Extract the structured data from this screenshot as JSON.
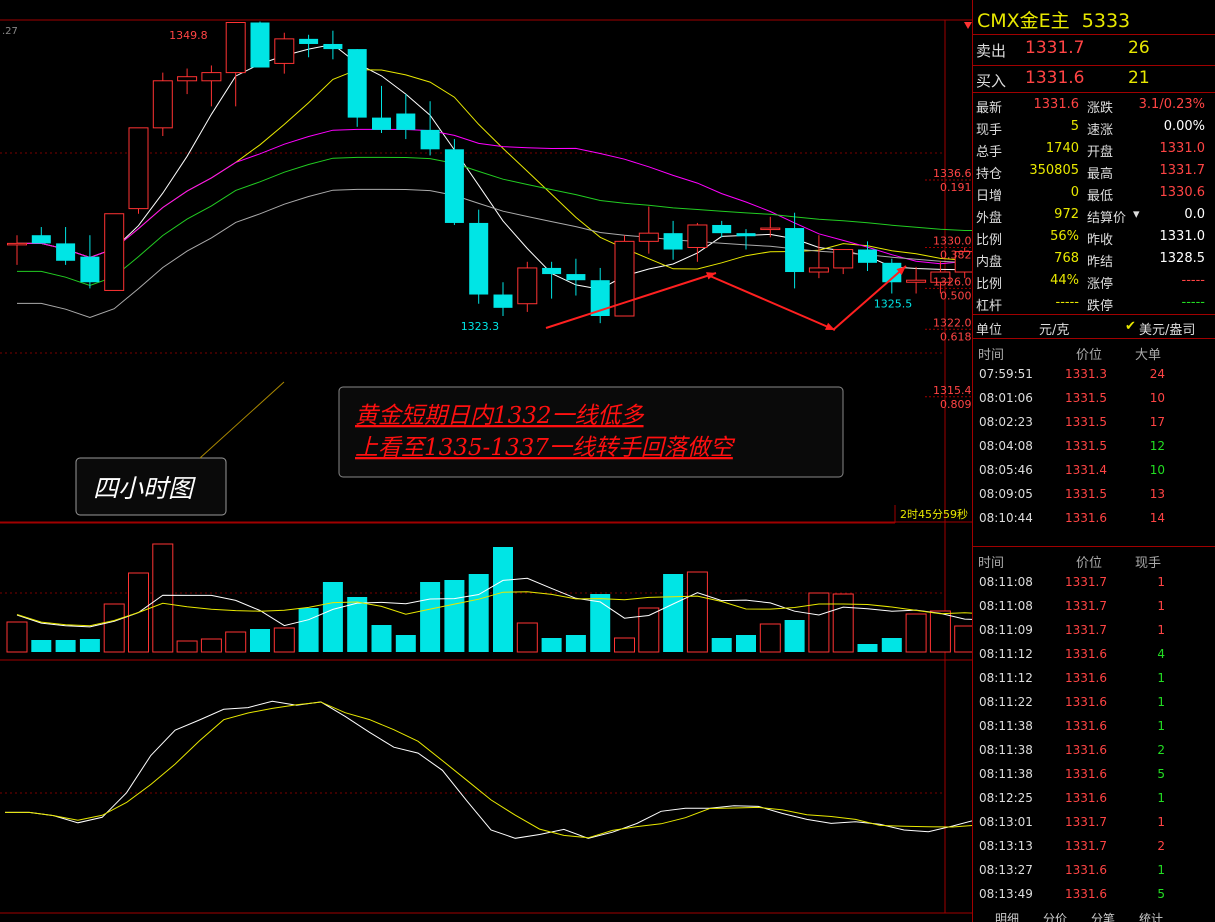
{
  "chart_data": {
    "type": "candlestick",
    "price_axis": {
      "min": 1307,
      "max": 1357
    },
    "candles": [
      {
        "o": 1330.4,
        "h": 1331.2,
        "l": 1328.3,
        "c": 1330.4
      },
      {
        "o": 1331.2,
        "h": 1332.0,
        "l": 1330.4,
        "c": 1330.4
      },
      {
        "o": 1330.4,
        "h": 1332.0,
        "l": 1328.3,
        "c": 1328.7
      },
      {
        "o": 1329.1,
        "h": 1331.2,
        "l": 1326.0,
        "c": 1326.6
      },
      {
        "o": 1325.8,
        "h": 1333.3,
        "l": 1325.8,
        "c": 1333.3
      },
      {
        "o": 1333.8,
        "h": 1341.7,
        "l": 1333.3,
        "c": 1341.7
      },
      {
        "o": 1341.7,
        "h": 1347.1,
        "l": 1340.9,
        "c": 1346.3
      },
      {
        "o": 1346.3,
        "h": 1347.5,
        "l": 1345.0,
        "c": 1346.7
      },
      {
        "o": 1346.3,
        "h": 1347.8,
        "l": 1343.8,
        "c": 1347.1
      },
      {
        "o": 1347.1,
        "h": 1349.8,
        "l": 1343.8,
        "c": 1352.0
      },
      {
        "o": 1352.0,
        "h": 1352.1,
        "l": 1347.6,
        "c": 1347.6
      },
      {
        "o": 1348.0,
        "h": 1351.0,
        "l": 1347.0,
        "c": 1350.4
      },
      {
        "o": 1350.4,
        "h": 1350.8,
        "l": 1348.6,
        "c": 1349.9
      },
      {
        "o": 1349.9,
        "h": 1351.2,
        "l": 1348.4,
        "c": 1349.4
      },
      {
        "o": 1349.4,
        "h": 1349.4,
        "l": 1341.8,
        "c": 1342.7
      },
      {
        "o": 1342.7,
        "h": 1345.8,
        "l": 1341.2,
        "c": 1341.5
      },
      {
        "o": 1343.1,
        "h": 1345.0,
        "l": 1340.6,
        "c": 1341.5
      },
      {
        "o": 1341.5,
        "h": 1344.3,
        "l": 1339.0,
        "c": 1339.6
      },
      {
        "o": 1339.6,
        "h": 1340.6,
        "l": 1332.2,
        "c": 1332.4
      },
      {
        "o": 1332.4,
        "h": 1333.7,
        "l": 1324.5,
        "c": 1325.4
      },
      {
        "o": 1325.4,
        "h": 1326.6,
        "l": 1323.3,
        "c": 1324.1
      },
      {
        "o": 1324.5,
        "h": 1328.6,
        "l": 1323.7,
        "c": 1328.0
      },
      {
        "o": 1328.0,
        "h": 1328.6,
        "l": 1325.0,
        "c": 1327.4
      },
      {
        "o": 1327.4,
        "h": 1328.9,
        "l": 1325.3,
        "c": 1326.8
      },
      {
        "o": 1326.8,
        "h": 1328.0,
        "l": 1322.6,
        "c": 1323.3
      },
      {
        "o": 1323.3,
        "h": 1331.2,
        "l": 1323.3,
        "c": 1330.6
      },
      {
        "o": 1330.6,
        "h": 1334.0,
        "l": 1329.4,
        "c": 1331.4
      },
      {
        "o": 1331.4,
        "h": 1332.6,
        "l": 1328.8,
        "c": 1329.8
      },
      {
        "o": 1330.0,
        "h": 1332.4,
        "l": 1328.6,
        "c": 1332.2
      },
      {
        "o": 1332.2,
        "h": 1332.6,
        "l": 1331.0,
        "c": 1331.4
      },
      {
        "o": 1331.4,
        "h": 1331.8,
        "l": 1329.8,
        "c": 1331.1
      },
      {
        "o": 1331.8,
        "h": 1333.0,
        "l": 1331.0,
        "c": 1331.9
      },
      {
        "o": 1331.9,
        "h": 1333.4,
        "l": 1326.0,
        "c": 1327.6
      },
      {
        "o": 1327.6,
        "h": 1331.2,
        "l": 1327.0,
        "c": 1328.0
      },
      {
        "o": 1328.0,
        "h": 1329.8,
        "l": 1327.4,
        "c": 1329.8
      },
      {
        "o": 1329.8,
        "h": 1330.6,
        "l": 1327.7,
        "c": 1328.5
      },
      {
        "o": 1328.5,
        "h": 1328.9,
        "l": 1325.5,
        "c": 1326.6
      },
      {
        "o": 1326.6,
        "h": 1328.1,
        "l": 1325.5,
        "c": 1326.8
      },
      {
        "o": 1326.6,
        "h": 1328.7,
        "l": 1325.5,
        "c": 1327.6
      },
      {
        "o": 1327.6,
        "h": 1330.0,
        "l": 1327.0,
        "c": 1329.6
      },
      {
        "o": 1329.6,
        "h": 1330.6,
        "l": 1328.8,
        "c": 1330.2
      }
    ],
    "candle_labels": [
      {
        "index": 7,
        "text": "1349.8",
        "value": 1349.8,
        "color": "#ff4444",
        "above": true
      },
      {
        "index": 19,
        "text": "1323.3",
        "value": 1323.3,
        "color": "#00e5e5",
        "above": false
      },
      {
        "index": 36,
        "text": "1325.5",
        "value": 1325.5,
        "color": "#00e5e5",
        "above": false
      }
    ],
    "fib_levels": [
      {
        "price": "1336.6",
        "ratio": "0.191",
        "value": 1336.6
      },
      {
        "price": "1330.0",
        "ratio": "0.382",
        "value": 1330.0
      },
      {
        "price": "1326.0",
        "ratio": "0.500",
        "value": 1326.0
      },
      {
        "price": "1322.0",
        "ratio": "0.618",
        "value": 1322.0
      },
      {
        "price": "1315.4",
        "ratio": "0.809",
        "value": 1315.4
      }
    ],
    "corner_label": ".27",
    "countdown": "2时45分59秒",
    "annotation_lines": [
      "黄金短期日内1332一线低多",
      "上看至1335-1337一线转手回落做空"
    ],
    "caption": "四小时图",
    "volumes": [
      30,
      12,
      12,
      13,
      48,
      79,
      108,
      11,
      13,
      20,
      23,
      24,
      44,
      70,
      55,
      27,
      17,
      70,
      72,
      78,
      105,
      29,
      14,
      17,
      58,
      14,
      44,
      78,
      80,
      14,
      17,
      28,
      32,
      59,
      58,
      8,
      14,
      38,
      41,
      26,
      2
    ]
  },
  "side": {
    "title": "CMX金E主",
    "code": "5333",
    "sell": {
      "label": "卖出",
      "price": "1331.7",
      "vol": "26"
    },
    "buy": {
      "label": "买入",
      "price": "1331.6",
      "vol": "21"
    },
    "quote": [
      {
        "l1": "最新",
        "v1": "1331.6",
        "c1": "red",
        "l2": "涨跌",
        "v2": "3.1/0.23%",
        "c2": "red"
      },
      {
        "l1": "现手",
        "v1": "5",
        "c1": "yel",
        "l2": "速涨",
        "v2": "0.00%",
        "c2": "wht"
      },
      {
        "l1": "总手",
        "v1": "1740",
        "c1": "yel",
        "l2": "开盘",
        "v2": "1331.0",
        "c2": "red"
      },
      {
        "l1": "持仓",
        "v1": "350805",
        "c1": "yel",
        "l2": "最高",
        "v2": "1331.7",
        "c2": "red"
      },
      {
        "l1": "日增",
        "v1": "0",
        "c1": "yel",
        "l2": "最低",
        "v2": "1330.6",
        "c2": "red"
      },
      {
        "l1": "外盘",
        "v1": "972",
        "c1": "yel",
        "l2": "结算价",
        "v2": "0.0",
        "c2": "wht"
      },
      {
        "l1": "比例",
        "v1": "56%",
        "c1": "yel",
        "l2": "昨收",
        "v2": "1331.0",
        "c2": "wht"
      },
      {
        "l1": "内盘",
        "v1": "768",
        "c1": "yel",
        "l2": "昨结",
        "v2": "1328.5",
        "c2": "wht"
      },
      {
        "l1": "比例",
        "v1": "44%",
        "c1": "yel",
        "l2": "涨停",
        "v2": "-----",
        "c2": "red"
      },
      {
        "l1": "杠杆",
        "v1": "-----",
        "c1": "yel",
        "l2": "跌停",
        "v2": "-----",
        "c2": "grn"
      }
    ],
    "unit": {
      "label": "单位",
      "opt1": "元/克",
      "opt2": "美元/盎司"
    },
    "big_orders": {
      "headers": [
        "时间",
        "价位",
        "大单"
      ],
      "rows": [
        {
          "t": "07:59:51",
          "p": "1331.3",
          "v": "24",
          "c": "red"
        },
        {
          "t": "08:01:06",
          "p": "1331.5",
          "v": "10",
          "c": "red"
        },
        {
          "t": "08:02:23",
          "p": "1331.5",
          "v": "17",
          "c": "red"
        },
        {
          "t": "08:04:08",
          "p": "1331.5",
          "v": "12",
          "c": "grn"
        },
        {
          "t": "08:05:46",
          "p": "1331.4",
          "v": "10",
          "c": "grn"
        },
        {
          "t": "08:09:05",
          "p": "1331.5",
          "v": "13",
          "c": "red"
        },
        {
          "t": "08:10:44",
          "p": "1331.6",
          "v": "14",
          "c": "red"
        }
      ]
    },
    "ticks": {
      "headers": [
        "时间",
        "价位",
        "现手"
      ],
      "rows": [
        {
          "t": "08:11:08",
          "p": "1331.7",
          "v": "1",
          "c": "red"
        },
        {
          "t": "08:11:08",
          "p": "1331.7",
          "v": "1",
          "c": "red"
        },
        {
          "t": "08:11:09",
          "p": "1331.7",
          "v": "1",
          "c": "red"
        },
        {
          "t": "08:11:12",
          "p": "1331.6",
          "v": "4",
          "c": "grn"
        },
        {
          "t": "08:11:12",
          "p": "1331.6",
          "v": "1",
          "c": "grn"
        },
        {
          "t": "08:11:22",
          "p": "1331.6",
          "v": "1",
          "c": "grn"
        },
        {
          "t": "08:11:38",
          "p": "1331.6",
          "v": "1",
          "c": "grn"
        },
        {
          "t": "08:11:38",
          "p": "1331.6",
          "v": "2",
          "c": "grn"
        },
        {
          "t": "08:11:38",
          "p": "1331.6",
          "v": "5",
          "c": "grn"
        },
        {
          "t": "08:12:25",
          "p": "1331.6",
          "v": "1",
          "c": "grn"
        },
        {
          "t": "08:13:01",
          "p": "1331.7",
          "v": "1",
          "c": "red"
        },
        {
          "t": "08:13:13",
          "p": "1331.7",
          "v": "2",
          "c": "red"
        },
        {
          "t": "08:13:27",
          "p": "1331.6",
          "v": "1",
          "c": "grn"
        },
        {
          "t": "08:13:49",
          "p": "1331.6",
          "v": "5",
          "c": "grn"
        }
      ]
    },
    "tabs": [
      "明细",
      "分价",
      "分笔",
      "统计"
    ]
  }
}
